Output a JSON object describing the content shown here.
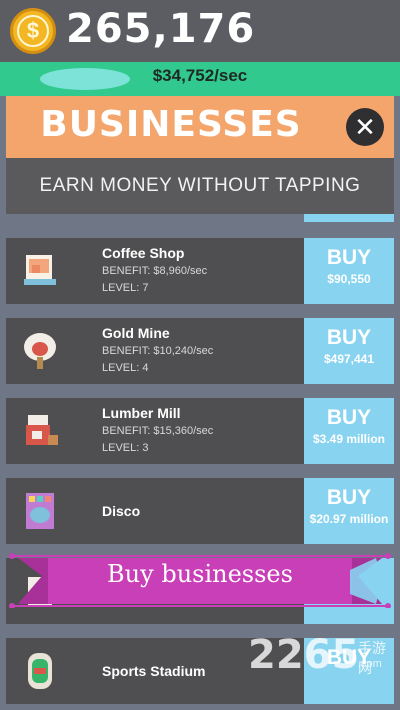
{
  "header": {
    "balance": "265,176",
    "coin_icon": "coin-icon",
    "income_rate": "$34,752/sec"
  },
  "modal": {
    "title": "BUSINESSES",
    "subtitle": "EARN MONEY WITHOUT TAPPING",
    "close_icon": "close-icon"
  },
  "businesses": [
    {
      "name": "Coffee Shop",
      "benefit": "BENEFIT: $8,960/sec",
      "level": "LEVEL: 7",
      "buy_label": "BUY",
      "price": "$90,550",
      "icon": "coffee-shop-icon"
    },
    {
      "name": "Gold Mine",
      "benefit": "BENEFIT: $10,240/sec",
      "level": "LEVEL: 4",
      "buy_label": "BUY",
      "price": "$497,441",
      "icon": "gold-mine-icon"
    },
    {
      "name": "Lumber Mill",
      "benefit": "BENEFIT: $15,360/sec",
      "level": "LEVEL: 3",
      "buy_label": "BUY",
      "price": "$3.49 million",
      "icon": "lumber-mill-icon"
    },
    {
      "name": "Disco",
      "buy_label": "BUY",
      "price": "$20.97 million",
      "icon": "disco-icon"
    },
    {
      "name": "",
      "buy_label": "",
      "price": "",
      "icon": "business-icon"
    },
    {
      "name": "Sports Stadium",
      "buy_label": "BUY",
      "price": "",
      "icon": "sports-stadium-icon"
    }
  ],
  "banner": {
    "text": "Buy businesses"
  },
  "watermark": {
    "number": "2265",
    "chinese": "手游网",
    "url": ".com"
  },
  "colors": {
    "accent_orange": "#f4a56c",
    "buy_blue": "#88d3ef",
    "banner_magenta": "#c93fb8",
    "coin_gold": "#f2b722"
  }
}
